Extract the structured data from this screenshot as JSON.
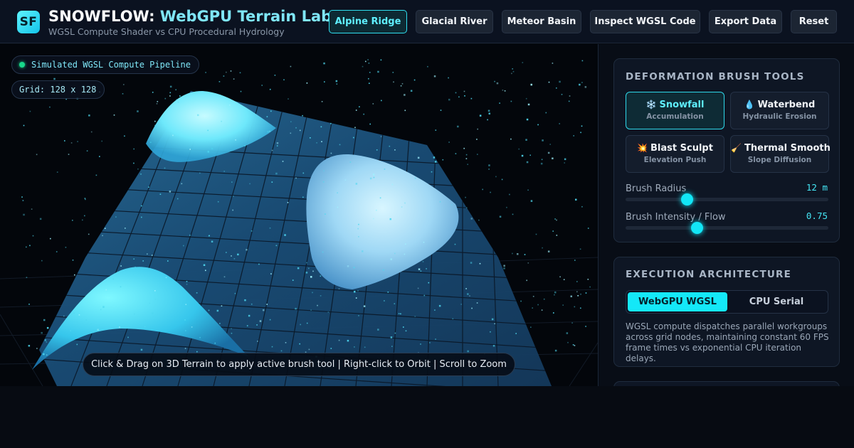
{
  "header": {
    "logo": "SF",
    "title_main": "SNOWFLOW:",
    "title_accent": "WebGPU Terrain Lab",
    "subtitle": "WGSL Compute Shader vs CPU Procedural Hydrology",
    "buttons": [
      {
        "label": "Alpine Ridge",
        "active": true
      },
      {
        "label": "Glacial River",
        "active": false
      },
      {
        "label": "Meteor Basin",
        "active": false
      },
      {
        "label": "Inspect WGSL Code",
        "active": false
      },
      {
        "label": "Export Data",
        "active": false
      },
      {
        "label": "Reset",
        "active": false
      }
    ]
  },
  "viewport": {
    "pipeline_badge": "Simulated WGSL Compute Pipeline",
    "grid_badge": "Grid: 128 x 128",
    "hint": "Click & Drag on 3D Terrain to apply active brush tool | Right-click to Orbit | Scroll to Zoom"
  },
  "brush_tools": {
    "title": "DEFORMATION BRUSH TOOLS",
    "tools": [
      {
        "icon": "❄️",
        "icon_name": "snowflake-icon",
        "name": "Snowfall",
        "sub": "Accumulation",
        "active": true
      },
      {
        "icon": "💧",
        "icon_name": "droplet-icon",
        "name": "Waterbend",
        "sub": "Hydraulic Erosion",
        "active": false
      },
      {
        "icon": "💥",
        "icon_name": "explosion-icon",
        "name": "Blast Sculpt",
        "sub": "Elevation Push",
        "active": false
      },
      {
        "icon": "🧹",
        "icon_name": "broom-icon",
        "name": "Thermal Smooth",
        "sub": "Slope Diffusion",
        "active": false
      }
    ],
    "radius_label": "Brush Radius",
    "radius_value": "12 m",
    "radius_fraction": 0.3,
    "intensity_label": "Brush Intensity / Flow",
    "intensity_value": "0.75",
    "intensity_fraction": 0.35
  },
  "architecture": {
    "title": "EXECUTION ARCHITECTURE",
    "options": [
      {
        "label": "WebGPU WGSL",
        "active": true
      },
      {
        "label": "CPU Serial",
        "active": false
      }
    ],
    "description": "WGSL compute dispatches parallel workgroups across grid nodes, maintaining constant 60 FPS frame times vs exponential CPU iteration delays."
  },
  "colors": {
    "accent": "#14e8f8",
    "background": "#070b12",
    "status_dot": "#18d98a"
  }
}
